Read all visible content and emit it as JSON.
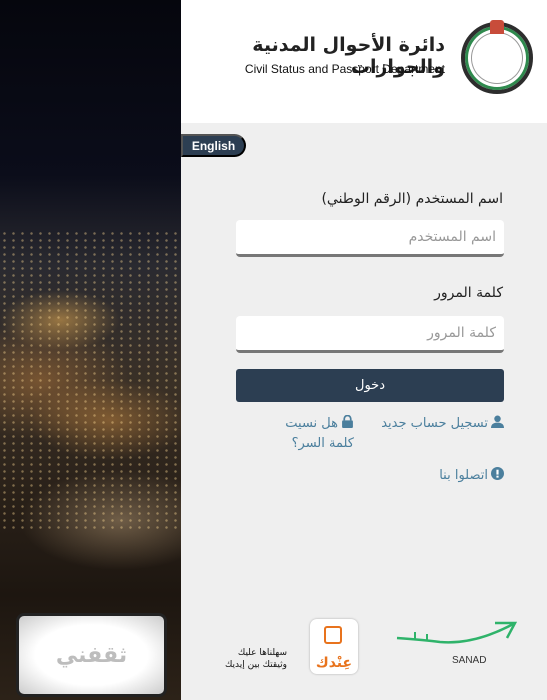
{
  "header": {
    "title_ar": "دائرة الأحوال المدنية والجوازات",
    "title_en": "Civil Status and Passport Department"
  },
  "language_button": "English",
  "form": {
    "username_label": "اسم المستخدم (الرقم الوطني)",
    "username_placeholder": "اسم المستخدم",
    "username_value": "",
    "password_label": "كلمة المرور",
    "password_placeholder": "كلمة المرور",
    "password_value": "",
    "login_label": "دخول"
  },
  "links": {
    "register": "تسجيل حساب جديد",
    "forgot_password": "هل نسيت كلمة السر؟",
    "contact": "اتصلوا بنا"
  },
  "icons": {
    "register": "user-icon",
    "forgot": "lock-icon",
    "contact": "exclamation-circle-icon"
  },
  "footer": {
    "thaqafni": "ثقفني",
    "andak": "عِنْدك",
    "slogan_line1": "سهلناها عليك",
    "slogan_line2": "وثيقتك بين إيديك",
    "sanad": "SANAD"
  },
  "colors": {
    "primary": "#2c3e52",
    "link": "#4b7f9d",
    "sanad_green": "#2fb36a",
    "andak_orange": "#e8731d"
  }
}
